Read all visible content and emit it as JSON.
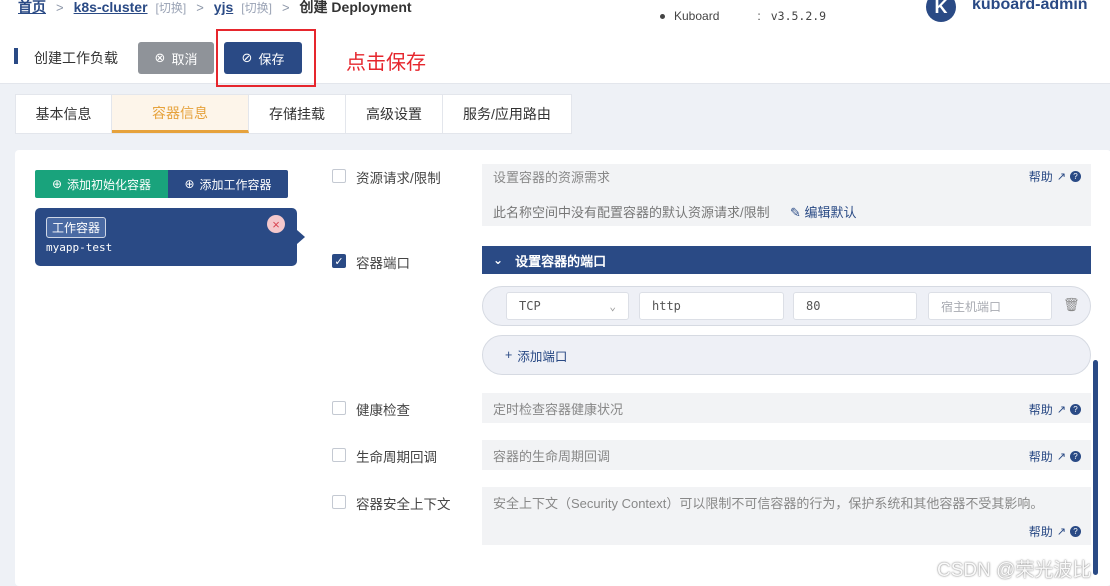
{
  "breadcrumb": {
    "home": "首页",
    "cluster": "k8s-cluster",
    "cluster_switch": "[切换]",
    "namespace": "yjs",
    "namespace_switch": "[切换]",
    "current": "创建 Deployment",
    "separator": ">"
  },
  "version": {
    "label": "Kuboard",
    "colon": ":",
    "value": "v3.5.2.9"
  },
  "user": {
    "avatar_letter": "K",
    "name": "kuboard-admin"
  },
  "page": {
    "title": "创建工作负载"
  },
  "actions": {
    "cancel_icon": "⊗",
    "cancel_label": "取消",
    "save_icon": "⊘",
    "save_label": "保存",
    "annotation": "点击保存"
  },
  "tabs": [
    {
      "label": "基本信息",
      "active": false
    },
    {
      "label": "容器信息",
      "active": true
    },
    {
      "label": "存储挂载",
      "active": false
    },
    {
      "label": "高级设置",
      "active": false
    },
    {
      "label": "服务/应用路由",
      "active": false
    }
  ],
  "containers": {
    "add_init_label": "添加初始化容器",
    "add_work_label": "添加工作容器",
    "card_tag": "工作容器",
    "card_name": "myapp-test",
    "close_icon": "×"
  },
  "sections": {
    "resources": {
      "label": "资源请求/限制",
      "hint": "设置容器的资源需求",
      "note": "此名称空间中没有配置容器的默认资源请求/限制",
      "edit_default": "编辑默认",
      "help": "帮助"
    },
    "ports": {
      "label": "容器端口",
      "header": "设置容器的端口",
      "protocol": "TCP",
      "name_value": "http",
      "port_value": "80",
      "host_port_placeholder": "宿主机端口",
      "add_port": "添加端口"
    },
    "health": {
      "label": "健康检查",
      "hint": "定时检查容器健康状况",
      "help": "帮助"
    },
    "lifecycle": {
      "label": "生命周期回调",
      "hint": "容器的生命周期回调",
      "help": "帮助"
    },
    "security": {
      "label": "容器安全上下文",
      "hint": "安全上下文（Security Context）可以限制不可信容器的行为，保护系统和其他容器不受其影响。",
      "help": "帮助"
    }
  },
  "watermark": "CSDN @荣光波比",
  "colors": {
    "primary": "#2a4a85",
    "accent": "#e6a23c",
    "success": "#19a37c",
    "annotation": "#e6262d"
  }
}
